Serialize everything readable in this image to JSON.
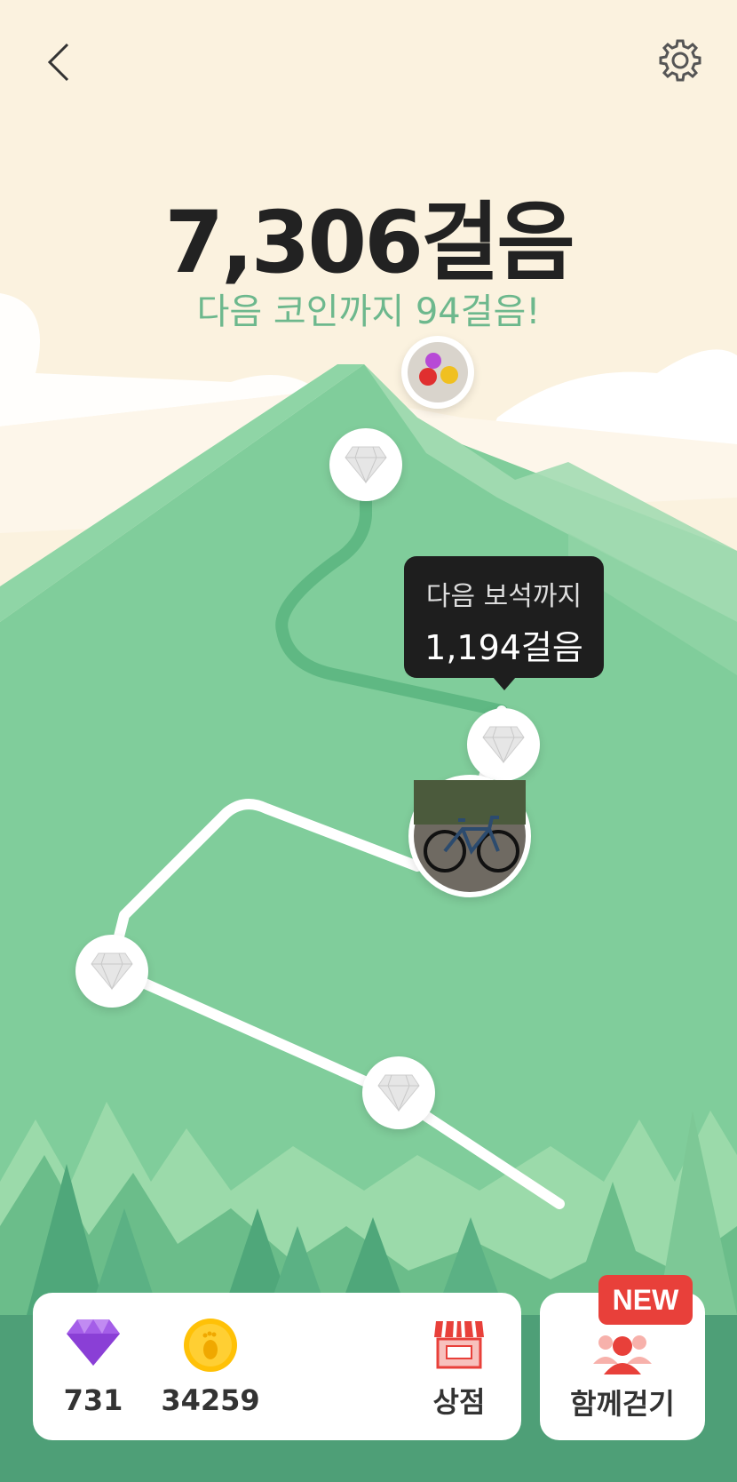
{
  "header": {
    "back_icon": "chevron-left-icon",
    "settings_icon": "gear-icon"
  },
  "steps": {
    "total": "7,306걸음",
    "next_coin": "다음 코인까지 94걸음!"
  },
  "tooltip": {
    "line1": "다음 보석까지",
    "line2": "1,194걸음"
  },
  "bottom": {
    "gems": "731",
    "coins": "34259",
    "shop_label": "상점",
    "walk_together_label": "함께걷기",
    "new_badge": "NEW"
  },
  "colors": {
    "sky": "#fbf2df",
    "mountain": "#80cd9b",
    "mountain_light": "#a9e0b8",
    "path_done": "#5fb883",
    "path": "#ffffff",
    "accent_text": "#6db88d",
    "badge": "#e8403a",
    "gem": "#9b59e0",
    "coin": "#ffc107"
  }
}
